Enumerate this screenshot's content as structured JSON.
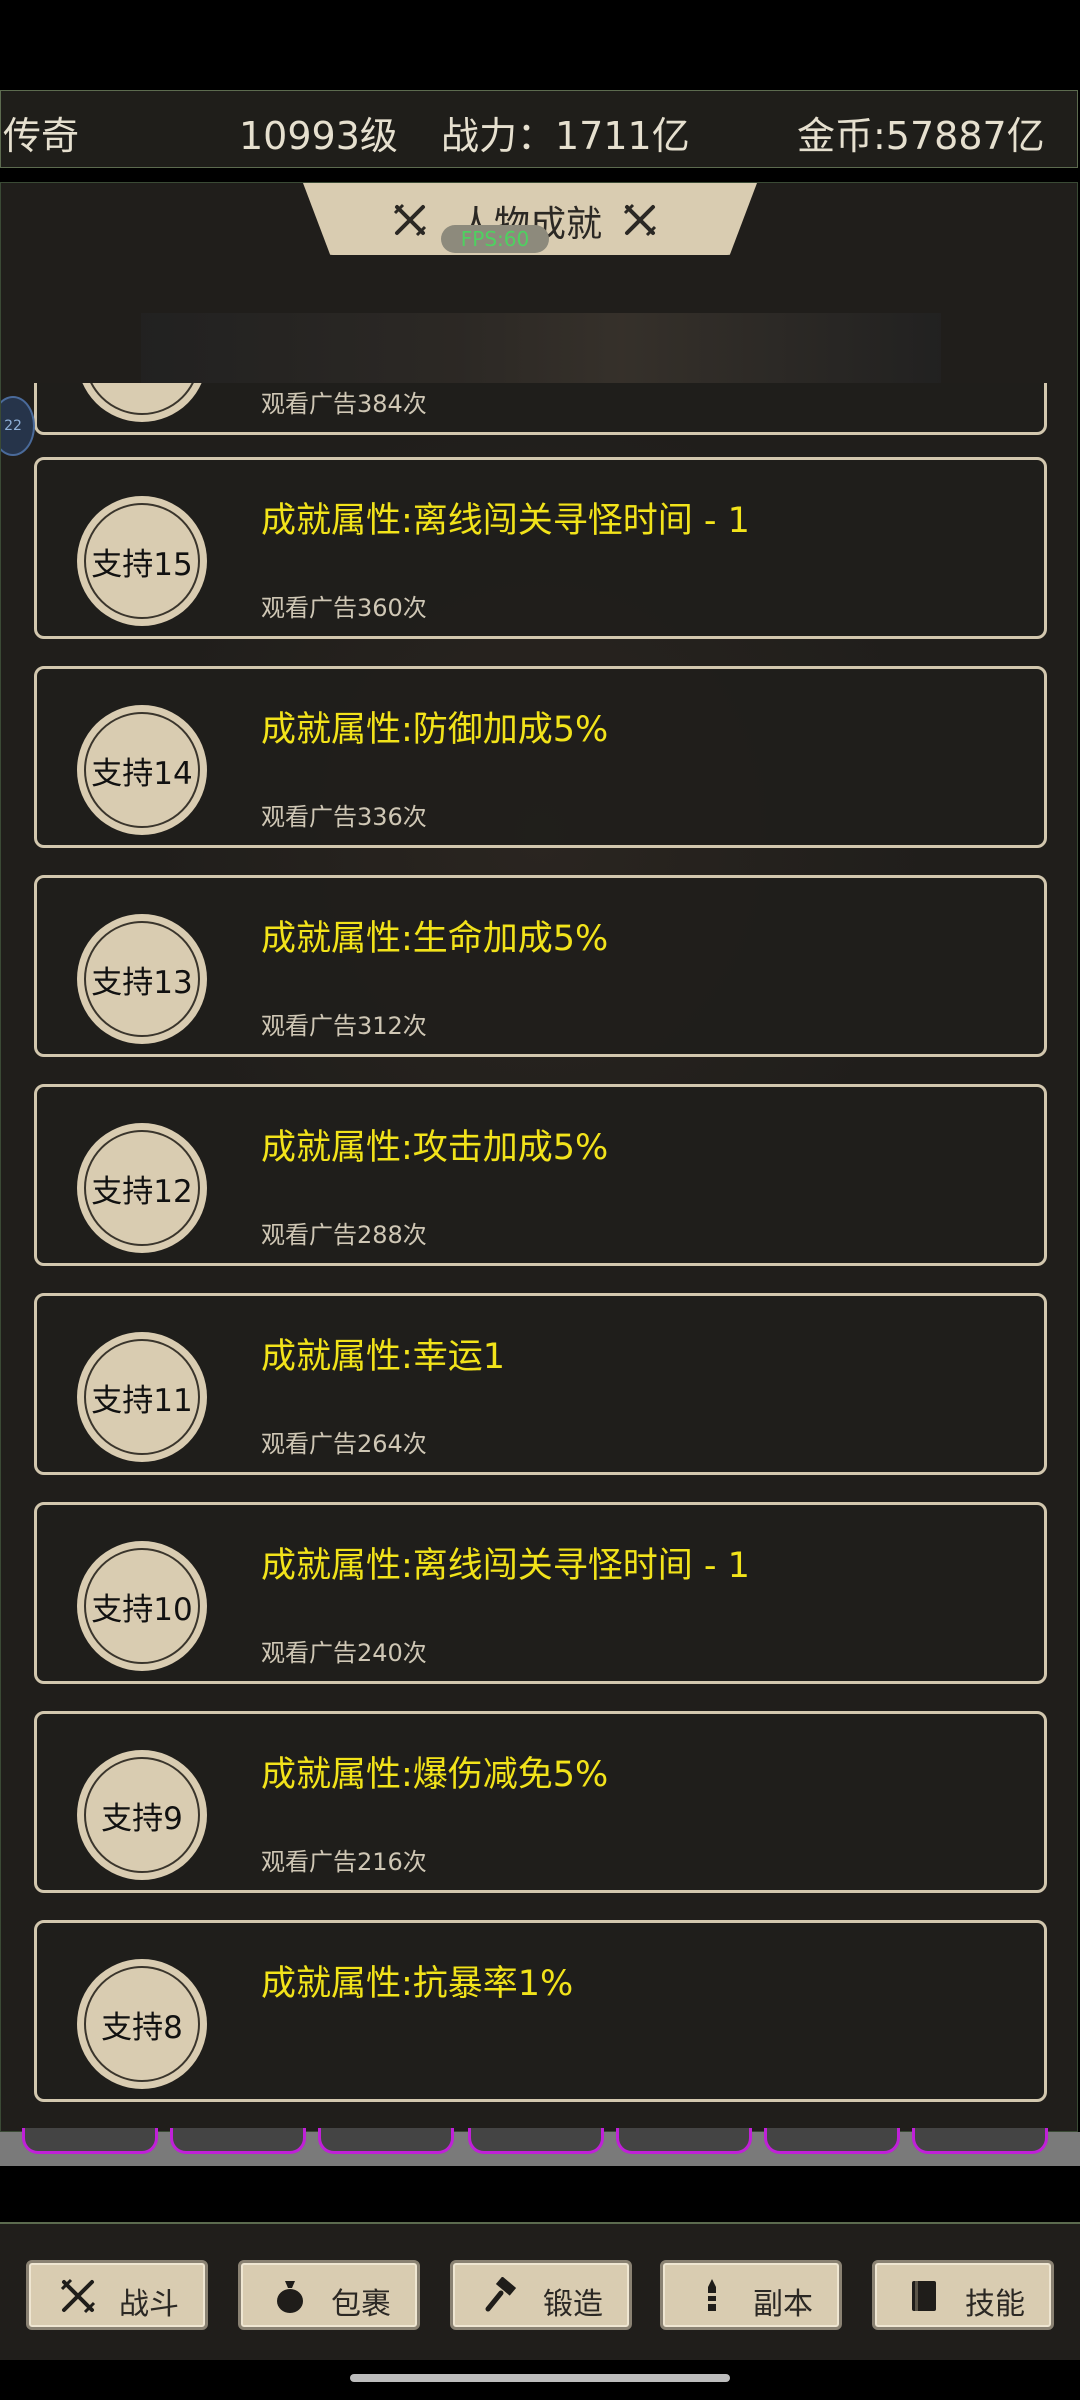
{
  "stats": {
    "title": "传奇",
    "level": "10993级",
    "power": "战力：1711亿",
    "gold": "金币:57887亿"
  },
  "panel": {
    "title": "人物成就",
    "fps_badge": "FPS:60",
    "side_bubble": "22"
  },
  "achievements": [
    {
      "badge": "",
      "title": "",
      "sub": "观看广告384次"
    },
    {
      "badge": "支持15",
      "title": "成就属性:离线闯关寻怪时间 - 1",
      "sub": "观看广告360次"
    },
    {
      "badge": "支持14",
      "title": "成就属性:防御加成5%",
      "sub": "观看广告336次"
    },
    {
      "badge": "支持13",
      "title": "成就属性:生命加成5%",
      "sub": "观看广告312次"
    },
    {
      "badge": "支持12",
      "title": "成就属性:攻击加成5%",
      "sub": "观看广告288次"
    },
    {
      "badge": "支持11",
      "title": "成就属性:幸运1",
      "sub": "观看广告264次"
    },
    {
      "badge": "支持10",
      "title": "成就属性:离线闯关寻怪时间 - 1",
      "sub": "观看广告240次"
    },
    {
      "badge": "支持9",
      "title": "成就属性:爆伤减免5%",
      "sub": "观看广告216次"
    },
    {
      "badge": "支持8",
      "title": "成就属性:抗暴率1%",
      "sub": ""
    }
  ],
  "nav": [
    {
      "label": "战斗",
      "icon": "crossed-swords-icon"
    },
    {
      "label": "包裹",
      "icon": "bag-icon"
    },
    {
      "label": "锻造",
      "icon": "hammer-icon"
    },
    {
      "label": "副本",
      "icon": "tower-icon"
    },
    {
      "label": "技能",
      "icon": "book-icon"
    }
  ],
  "colors": {
    "accent_title": "#f2e31a",
    "panel_bg": "#201e1b",
    "card_border": "#d2c7ae",
    "badge_fill": "#d9ccb1",
    "deco_border": "#c020d8"
  }
}
